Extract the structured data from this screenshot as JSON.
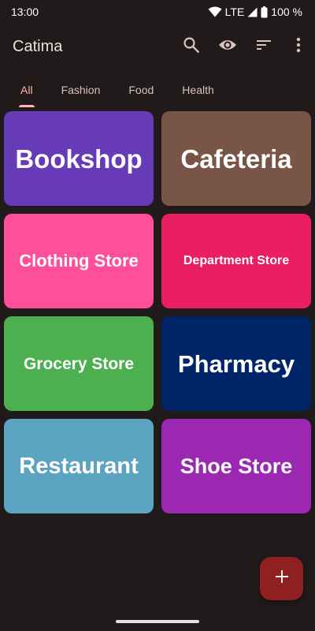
{
  "status_bar": {
    "time": "13:00",
    "network": "LTE",
    "battery": "100 %",
    "icons": [
      "wifi-icon",
      "cellular-signal-icon",
      "battery-icon"
    ]
  },
  "app_bar": {
    "title": "Catima",
    "actions": [
      {
        "name": "search",
        "icon": "search-icon"
      },
      {
        "name": "view",
        "icon": "eye-icon"
      },
      {
        "name": "sort",
        "icon": "sort-icon"
      },
      {
        "name": "more",
        "icon": "more-vertical-icon"
      }
    ]
  },
  "tabs": [
    {
      "label": "All",
      "active": true
    },
    {
      "label": "Fashion",
      "active": false
    },
    {
      "label": "Food",
      "active": false
    },
    {
      "label": "Health",
      "active": false
    }
  ],
  "cards": [
    {
      "label": "Bookshop",
      "color": "#673ab7"
    },
    {
      "label": "Cafeteria",
      "color": "#795548"
    },
    {
      "label": "Clothing Store",
      "color": "#ff4f9a"
    },
    {
      "label": "Department Store",
      "color": "#e91e63"
    },
    {
      "label": "Grocery Store",
      "color": "#4caf50"
    },
    {
      "label": "Pharmacy",
      "color": "#002569"
    },
    {
      "label": "Restaurant",
      "color": "#5ba4c1"
    },
    {
      "label": "Shoe Store",
      "color": "#9c27b0"
    }
  ],
  "fab": {
    "icon": "plus-icon",
    "color": "#8f1f20"
  },
  "colors": {
    "background": "#201a1a",
    "accent": "#ffb3ad",
    "on_surface": "#ece0df"
  }
}
